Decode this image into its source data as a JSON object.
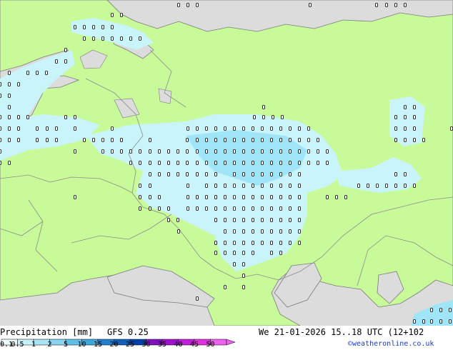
{
  "title": {
    "product": "Precipitation [mm]",
    "model": "GFS 0.25",
    "datetime": "We 21-01-2026 15..18 UTC (12+102",
    "credit": "©weatheronline.co.uk"
  },
  "legend": {
    "tick_labels": [
      "0.1",
      "0.5",
      "1",
      "2",
      "5",
      "10",
      "15",
      "20",
      "25",
      "30",
      "35",
      "40",
      "45",
      "50"
    ],
    "colors": [
      "#f0ffff",
      "#c8f0f8",
      "#a8e4f4",
      "#88d4ee",
      "#60c0e8",
      "#3ca8dc",
      "#2080cc",
      "#1060bc",
      "#0040a8",
      "#8010c0",
      "#a010d0",
      "#c020d8",
      "#e030e0",
      "#f060f0"
    ]
  },
  "map_colors": {
    "land": "#c8fa9a",
    "sea_outside": "#dcdcdc",
    "precip_light": "#c8f4fa",
    "precip_medium": "#a0e4f8",
    "border": "#8c8c8c",
    "coast": "#7a7a7a"
  }
}
